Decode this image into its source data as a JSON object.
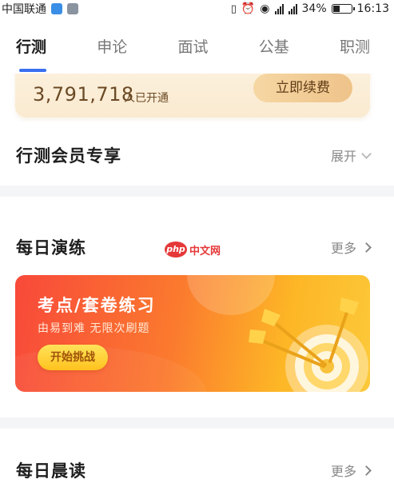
{
  "status_bar": {
    "carrier": "中国联通",
    "battery": "34%",
    "time": "16:13"
  },
  "tabs": [
    {
      "label": "行测",
      "active": true
    },
    {
      "label": "申论",
      "active": false
    },
    {
      "label": "面试",
      "active": false
    },
    {
      "label": "公基",
      "active": false
    },
    {
      "label": "职测",
      "active": false
    }
  ],
  "vip": {
    "count": "3,791,718",
    "count_label": "人已开通",
    "button": "立即续费"
  },
  "member_section": {
    "title": "行测会员专享",
    "action": "展开"
  },
  "daily_practice": {
    "title": "每日演练",
    "more": "更多",
    "card": {
      "title": "考点/套卷练习",
      "subtitle": "由易到难  无限次刷题",
      "button": "开始挑战"
    }
  },
  "watermark": {
    "logo": "php",
    "text": "中文网"
  },
  "daily_reading": {
    "title": "每日晨读",
    "more": "更多"
  },
  "colors": {
    "accent": "#3a6ff0",
    "card_start": "#f8493a",
    "card_end": "#fcc93a",
    "vip_bg": "#fdf4e4"
  }
}
